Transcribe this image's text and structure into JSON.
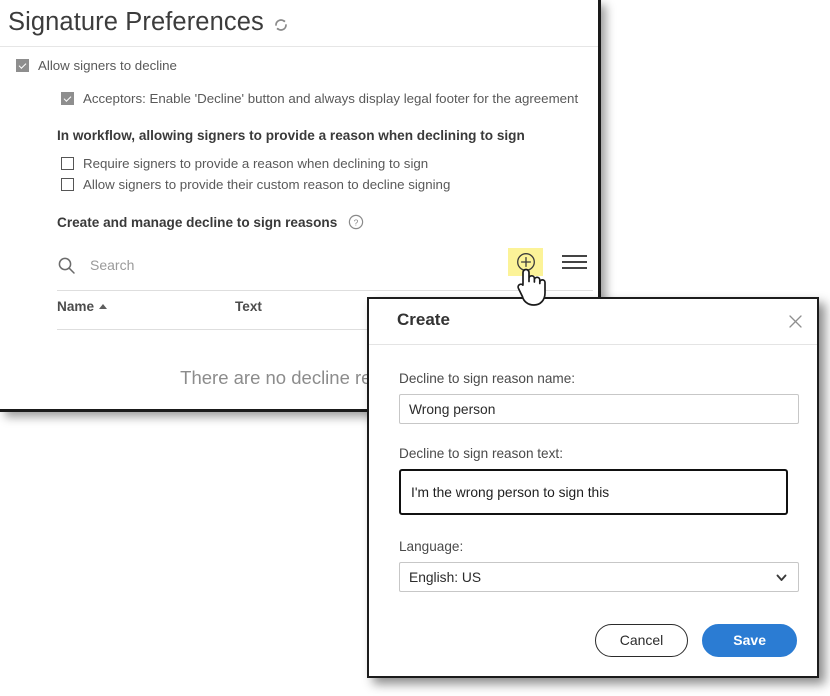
{
  "page": {
    "title": "Signature Preferences",
    "refresh_icon": "refresh-icon"
  },
  "settings": {
    "allow_decline": {
      "label": "Allow signers to decline",
      "checked": true
    },
    "acceptors": {
      "label": "Acceptors: Enable 'Decline' button and always display legal footer for the agreement",
      "checked": true
    },
    "workflow_heading": "In workflow, allowing signers to provide a reason when declining to sign",
    "require_reason": {
      "label": "Require signers to provide a reason when declining to sign",
      "checked": false
    },
    "custom_reason": {
      "label": "Allow signers to provide their custom reason to decline signing",
      "checked": false
    },
    "create_manage_heading": "Create and manage decline to sign reasons",
    "help_icon": "help-circle-icon"
  },
  "toolbar": {
    "search_placeholder": "Search",
    "search_value": "",
    "search_icon": "search-icon",
    "add_icon": "plus-circle-icon",
    "add_highlight_color": "#fcf398",
    "menu_icon": "hamburger-menu-icon"
  },
  "table": {
    "columns": [
      {
        "label": "Name",
        "sorted": "asc"
      },
      {
        "label": "Text",
        "sorted": ""
      }
    ],
    "empty_message": "There are no decline reasons"
  },
  "dialog": {
    "title": "Create",
    "close_icon": "close-icon",
    "name_label": "Decline to sign reason name:",
    "name_value": "Wrong person",
    "text_label": "Decline to sign reason text:",
    "text_value": "I'm the wrong person to sign this",
    "language_label": "Language:",
    "language_value": "English: US",
    "language_options": [
      "English: US"
    ],
    "chevron_icon": "chevron-down-icon",
    "cancel_label": "Cancel",
    "save_label": "Save",
    "save_color": "#2b7cd3"
  },
  "cursor": {
    "icon": "hand-pointer-cursor"
  }
}
